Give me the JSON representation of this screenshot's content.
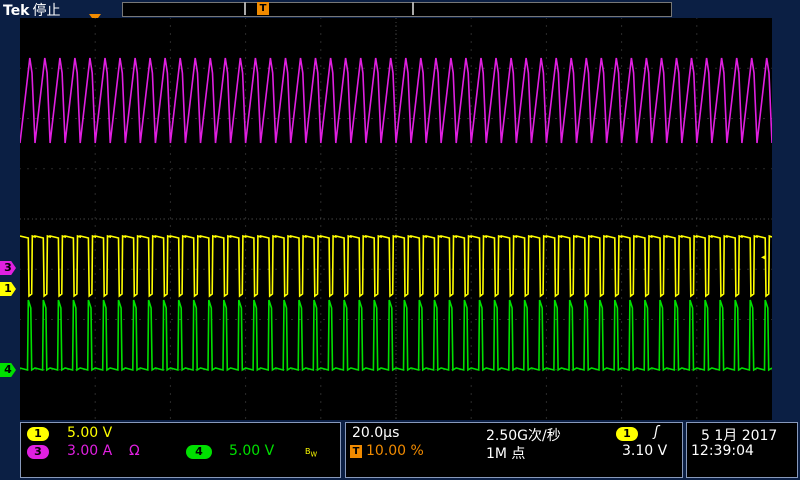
{
  "header": {
    "brand": "Tek",
    "mode": "停止",
    "trigger_marker": "T"
  },
  "channels": {
    "ch1": {
      "marker": "1",
      "scale": "5.00 V",
      "color": "#ffff00"
    },
    "ch3": {
      "marker": "3",
      "scale": "3.00 A",
      "impedance": "Ω",
      "color": "#e020e0"
    },
    "ch4": {
      "marker": "4",
      "scale": "5.00 V",
      "bw_icon": "bandwidth-limit-icon",
      "color": "#00e000"
    }
  },
  "horizontal": {
    "time_per_div": "20.0μs",
    "sample_rate": "2.50G次/秒",
    "trigger_position": "10.00 %",
    "record_length": "1M 点"
  },
  "trigger": {
    "source": "1",
    "slope_icon": "rising-edge-icon",
    "level": "3.10 V"
  },
  "datetime": {
    "date": "5 1月 2017",
    "time": "12:39:04"
  },
  "accent_color": "#f08a00"
}
